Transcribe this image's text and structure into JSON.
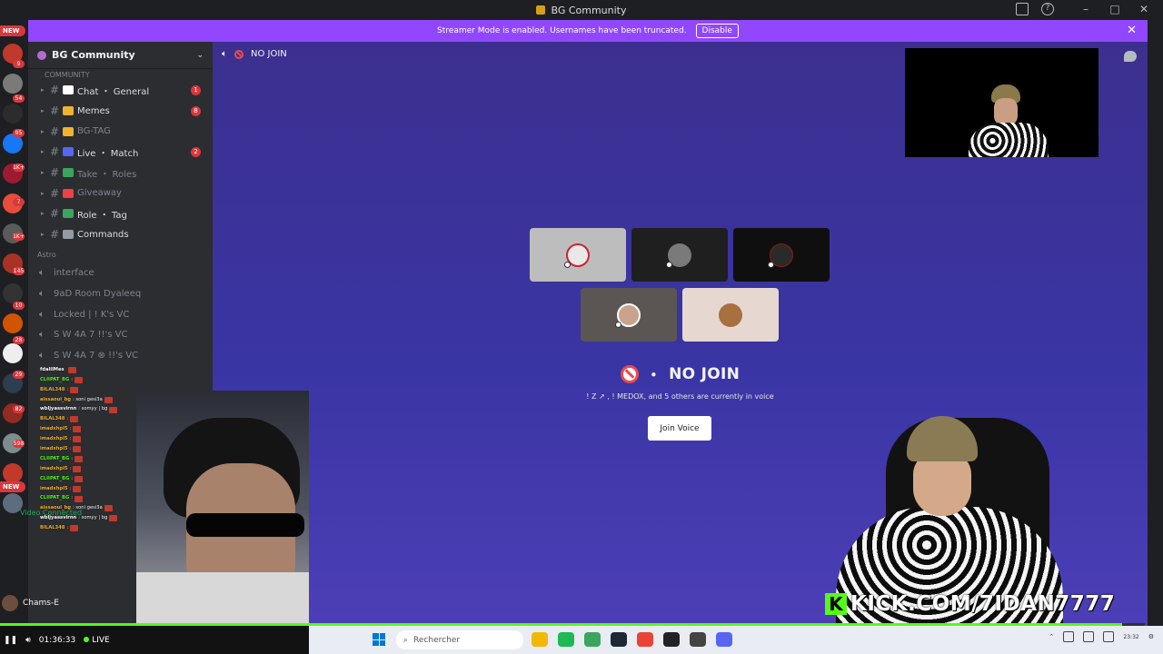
{
  "window": {
    "title": "BG Community"
  },
  "banner": {
    "text": "Streamer Mode is enabled. Usernames have been truncated.",
    "disable_label": "Disable"
  },
  "rail_badges": [
    "9",
    "54",
    "95",
    "1K+",
    "7",
    "1K+",
    "145",
    "10",
    "28",
    "29",
    "82",
    "598"
  ],
  "rail_new_label": "NEW",
  "server": {
    "name": "BG Community",
    "category": "COMMUNITY",
    "channels": [
      {
        "name": "Chat ・ General",
        "badge": "1",
        "muted": false,
        "color": "#ffffff"
      },
      {
        "name": "Memes",
        "badge": "8",
        "muted": false,
        "color": "#f0b232"
      },
      {
        "name": "BG-TAG",
        "badge": "",
        "muted": true,
        "color": "#f0b232"
      },
      {
        "name": "Live ・ Match",
        "badge": "2",
        "muted": false,
        "color": "#5865f2"
      },
      {
        "name": "Take ・ Roles",
        "badge": "",
        "muted": true,
        "color": "#3ba55d"
      },
      {
        "name": "Giveaway",
        "badge": "",
        "muted": true,
        "color": "#ed4245"
      },
      {
        "name": "Role ・ Tag",
        "badge": "",
        "muted": false,
        "color": "#3ba55d"
      },
      {
        "name": "Commands",
        "badge": "",
        "muted": false,
        "color": "#949ba4"
      }
    ],
    "astro_label": "Astro",
    "voice_channels": [
      "interface",
      "9aD Room Dyaleeq",
      "Locked | ! K's VC",
      "S W 4A 7 !!'s VC",
      "S W 4A 7 ⊗ !!'s VC"
    ]
  },
  "voice": {
    "channel_name": "NO JOIN",
    "subtitle": "! Z ↗ , ! MEDOX, and 5 others are currently in voice",
    "join_label": "Join Voice"
  },
  "chat_overlay": [
    {
      "user": "fdalilMes",
      "msg": "",
      "color": "#ffffff"
    },
    {
      "user": "CLIIPAT_BG",
      "msg": ":",
      "color": "#53fc18"
    },
    {
      "user": "BILAL348",
      "msg": ":",
      "color": "#f0b232"
    },
    {
      "user": "aissaoui_bg",
      "msg": ": soni gesi3a",
      "color": "#f0b232"
    },
    {
      "user": "wbljyassvirnn",
      "msg": ": somyy | bg",
      "color": "#ffffff"
    },
    {
      "user": "BILAL348",
      "msg": ":",
      "color": "#f0b232"
    },
    {
      "user": "imadxhpl5",
      "msg": ":",
      "color": "#f0b232"
    },
    {
      "user": "imadxhpl5",
      "msg": ":",
      "color": "#f0b232"
    },
    {
      "user": "imadxhpl5",
      "msg": ":",
      "color": "#f0b232"
    },
    {
      "user": "CLIIPAT_BG",
      "msg": ":",
      "color": "#53fc18"
    },
    {
      "user": "imadxhpl5",
      "msg": ":",
      "color": "#f0b232"
    },
    {
      "user": "CLIIPAT_BG",
      "msg": ":",
      "color": "#53fc18"
    },
    {
      "user": "imadxhpl5",
      "msg": ":",
      "color": "#f0b232"
    },
    {
      "user": "CLIIPAT_BG",
      "msg": ":",
      "color": "#53fc18"
    },
    {
      "user": "aissaoui_bg",
      "msg": ": soni gesi3a",
      "color": "#f0b232"
    },
    {
      "user": "wbljyassvirnn",
      "msg": ": somyy | bg",
      "color": "#ffffff"
    },
    {
      "user": "BILAL348",
      "msg": ":",
      "color": "#f0b232"
    }
  ],
  "video_connected_label": "Video Connected",
  "user_panel": {
    "name": "Chams-E"
  },
  "kick": {
    "url": "KICK.COM/7IDAN7777",
    "logo_letter": "K"
  },
  "player": {
    "time": "01:36:33",
    "live_label": "LIVE",
    "progress": 0.98
  },
  "taskbar": {
    "search_placeholder": "Rechercher",
    "clock_time": "23:32",
    "apps": [
      "#f2b705",
      "#1db954",
      "#3ba55d",
      "#1b2838",
      "#ea4335",
      "#222222",
      "#444444",
      "#5865f2"
    ]
  },
  "colors": {
    "accent_purple": "#9147ff",
    "kick_green": "#53fc18",
    "danger": "#da373c"
  }
}
